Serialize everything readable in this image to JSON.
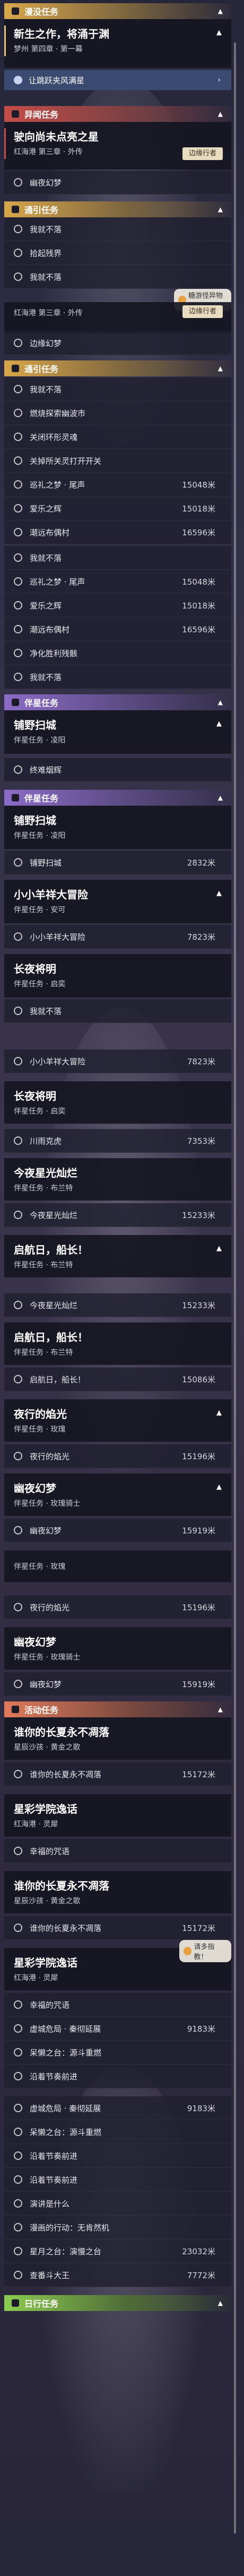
{
  "watermark": "糖游怪异物语",
  "watermark2": "请多指教！",
  "badge": "边缘行者",
  "headers": {
    "dream": "漫没任务",
    "rare": "异闻任务",
    "general": "通引任务",
    "companion": "伴星任务",
    "event": "活动任务",
    "daily": "日行任务"
  },
  "cards": {
    "c1": {
      "title": "新生之作，将涌于渊",
      "sub": "梦州 第四章 · 第一幕"
    },
    "c2": {
      "title": "驶向尚未点亮之星",
      "sub": "红海港 第三章 · 外传"
    },
    "c3sub": "红海港 第三章 · 外传",
    "c4": {
      "title": "铺野扫城",
      "sub": "伴星任务 · 凌阳"
    },
    "c5": {
      "title": "小小羊祥大冒险",
      "sub": "伴星任务 · 安可"
    },
    "c6": {
      "title": "长夜将明",
      "sub": "伴星任务 · 启奕"
    },
    "c7": {
      "title": "今夜星光灿烂",
      "sub": "伴星任务 · 布兰特"
    },
    "c8": {
      "title": "启航日，船长！",
      "sub": "伴星任务 · 布兰特"
    },
    "c9": {
      "title": "夜行的焰光",
      "sub": "伴星任务 · 玫瑰"
    },
    "c10": {
      "title": "幽夜幻梦",
      "sub": "伴星任务 · 玫瑰骑士"
    },
    "c11": {
      "title": "谁你的长夏永不凋落",
      "sub": "星辰沙孩 · 黄金之歌"
    },
    "c12": {
      "title": "星彩学院逸话",
      "sub": "红海港 · 灵犀"
    }
  },
  "rows": {
    "r_cross": "让跳跃夹风满星",
    "r_ink": "幽夜幻梦",
    "r_a1": "我就不落",
    "r_a2": "拾起残界",
    "r_a3": "我就不落",
    "r_a4": "边缘幻梦",
    "r_b1": "我就不落",
    "r_b2": "燃烧探索幽波市",
    "r_b3": "关闭环形灵魂",
    "r_b4": "关掉所关灵打开开关",
    "r_b5": "巡礼之梦 · 尾声",
    "r_b5d": "15048米",
    "r_b6": "爱乐之辉",
    "r_b6d": "15018米",
    "r_b7": "潮远布偶村",
    "r_b7d": "16596米",
    "r_b8": "我就不落",
    "r_b9": "巡礼之梦 · 尾声",
    "r_b9d": "15048米",
    "r_b10": "爱乐之辉",
    "r_b10d": "15018米",
    "r_b11": "潮远布偶村",
    "r_b11d": "16596米",
    "r_b12": "净化胜利残骸",
    "r_b13": "我就不落",
    "r_c1": "终难烟辉",
    "r_c2": "铺野扫城",
    "r_c2d": "2832米",
    "r_c3": "小小羊祥大冒险",
    "r_c3d": "7823米",
    "r_c4": "小小羊祥大冒险",
    "r_c4d": "7823米",
    "r_c5": "川雨克虎",
    "r_c5d": "7353米",
    "r_c6": "今夜星光灿烂",
    "r_c6d": "15233米",
    "r_c7": "今夜星光灿烂",
    "r_c7d": "15233米",
    "r_c8": "启航日，船长！",
    "r_c8d": "15086米",
    "r_c9": "夜行的焰光",
    "r_c9d": "15196米",
    "r_c10": "夜行的焰光",
    "r_c10d": "15196米",
    "r_c11": "幽夜幻梦",
    "r_c11d": "15919米",
    "r_e1": "谁你的长夏永不凋落",
    "r_e1d": "15172米",
    "r_e2": "谁你的长夏永不凋落",
    "r_e2d": "15172米",
    "r_e3": "幸福的咒语",
    "r_e4": "虚城危局 · 秦彻延展",
    "r_e4d": "9183米",
    "r_e5": "呆懒之台：源斗重燃",
    "r_e6": "沿着节奏前进",
    "r_e7": "虚城危局 · 秦彻延展",
    "r_e7d": "9183米",
    "r_e8": "呆懒之台：源斗重燃",
    "r_e9": "沿着节奏前进",
    "r_e10": "演讲是什么",
    "r_e11": "漫画的行动：无肯然机",
    "r_e12": "星月之台：演慢之台",
    "r_e12d": "23032米",
    "r_e13": "查番斗大王",
    "r_e13d": "7772米"
  }
}
